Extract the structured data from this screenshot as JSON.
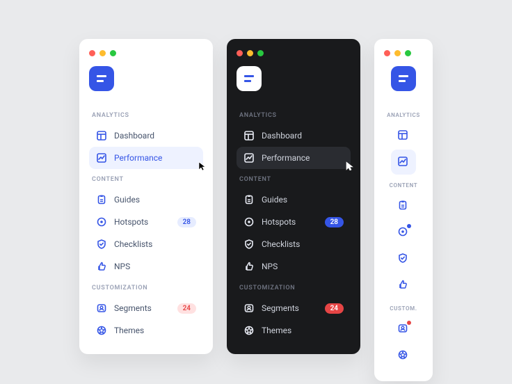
{
  "sections": {
    "analytics_label": "ANALYTICS",
    "content_label": "CONTENT",
    "customization_label": "CUSTOMIZATION",
    "customization_label_short": "CUSTOM."
  },
  "items": {
    "dashboard": "Dashboard",
    "performance": "Performance",
    "guides": "Guides",
    "hotspots": "Hotspots",
    "checklists": "Checklists",
    "nps": "NPS",
    "segments": "Segments",
    "themes": "Themes"
  },
  "badges": {
    "hotspots": "28",
    "segments": "24"
  },
  "selected": "performance",
  "colors": {
    "brand": "#3555e6",
    "badge_red": "#e64545",
    "dark_bg": "#191a1c",
    "page_bg": "#e9eaec"
  }
}
